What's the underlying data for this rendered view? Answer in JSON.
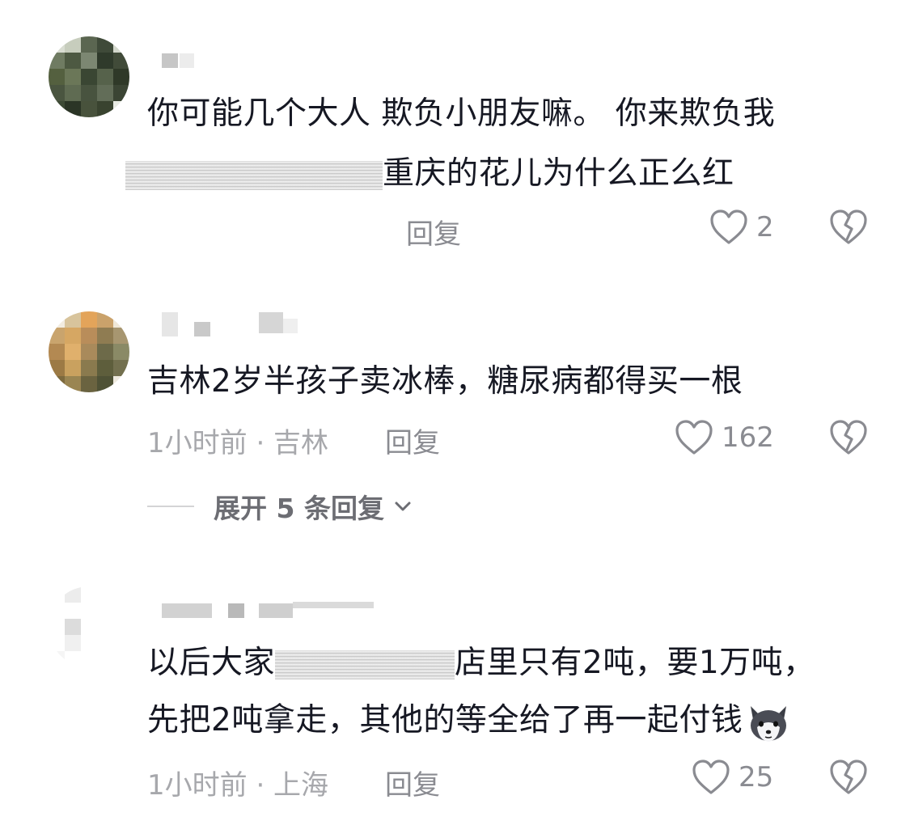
{
  "comments": [
    {
      "text_line1": "你可能几个大人 欺负小朋友嘛。 你来欺负我",
      "text_line2_visible": "重庆的花儿为什么正么红",
      "timestamp_location": "",
      "reply_label": "回复",
      "like_count": "2",
      "icons": {
        "like": "heart-outline-icon",
        "dislike": "broken-heart-icon"
      }
    },
    {
      "text_line1": "吉林2岁半孩子卖冰棒，糖尿病都得买一根",
      "timestamp_location": "1小时前 · 吉林",
      "reply_label": "回复",
      "like_count": "162",
      "expand_label": "展开 5 条回复",
      "icons": {
        "like": "heart-outline-icon",
        "dislike": "broken-heart-icon",
        "expand": "chevron-down-icon"
      }
    },
    {
      "text_line1_left": "以后大家",
      "text_line1_right": "店里只有2吨，要1万吨，",
      "text_line2": "先把2吨拿走，其他的等全给了再一起付钱",
      "timestamp_location": "1小时前 · 上海",
      "reply_label": "回复",
      "like_count": "25",
      "icons": {
        "like": "heart-outline-icon",
        "dislike": "broken-heart-icon",
        "emoji": "wolf-emoji-icon"
      }
    }
  ],
  "colors": {
    "text": "#161823",
    "meta": "#a7a8ac",
    "action": "#8a8b91"
  }
}
